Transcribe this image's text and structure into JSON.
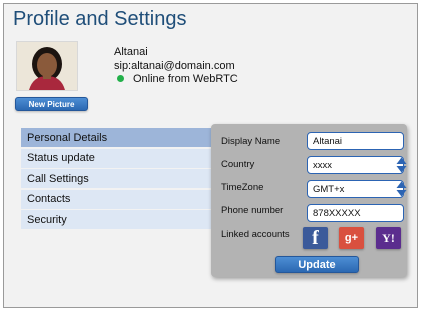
{
  "page": {
    "title": "Profile and Settings"
  },
  "profile": {
    "new_picture_label": "New Picture",
    "name": "Altanai",
    "sip": "sip:altanai@domain.com",
    "status": "Online from WebRTC",
    "status_color": "#22b04a"
  },
  "menu": {
    "items": [
      {
        "label": "Personal Details",
        "active": true
      },
      {
        "label": "Status update",
        "active": false
      },
      {
        "label": "Call Settings",
        "active": false
      },
      {
        "label": "Contacts",
        "active": false
      },
      {
        "label": "Security",
        "active": false
      }
    ]
  },
  "form": {
    "display_name_label": "Display Name",
    "display_name_value": "Altanai",
    "country_label": "Country",
    "country_value": "xxxx",
    "timezone_label": "TimeZone",
    "timezone_value": "GMT+x",
    "phone_label": "Phone number",
    "phone_value": "878XXXXX",
    "linked_label": "Linked accounts",
    "linked_accounts": [
      {
        "icon": "facebook-icon",
        "glyph": "f"
      },
      {
        "icon": "google-plus-icon",
        "glyph": "g+"
      },
      {
        "icon": "yahoo-icon",
        "glyph": "Y!"
      }
    ],
    "update_label": "Update"
  },
  "colors": {
    "title": "#1f4e79",
    "accent_blue": "#2c64b3",
    "menu_active": "#9db5d9",
    "menu_item": "#dde7f4",
    "panel": "#b3b3b3"
  }
}
